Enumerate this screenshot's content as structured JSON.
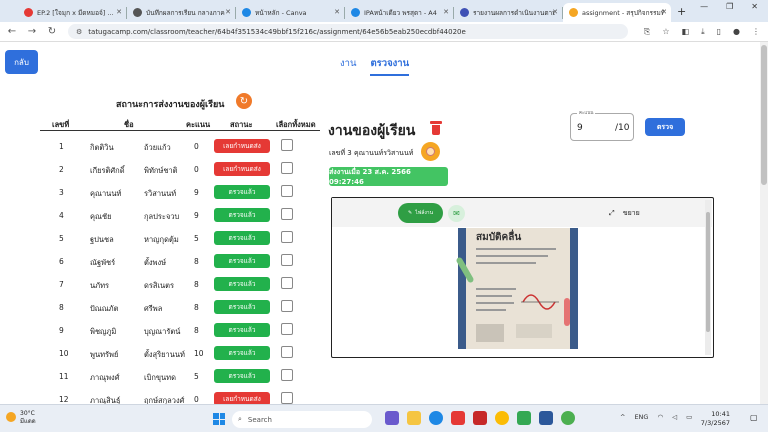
{
  "browser": {
    "tabs": [
      {
        "label": "EP.2 [ใจมุก x มีดหมอจ์] ...",
        "icon_color": "#e53935",
        "active": false
      },
      {
        "label": "บันทึกผลการเรียน กลางภาค",
        "icon_color": "#555555",
        "active": false
      },
      {
        "label": "หน้าหลัก - Canva",
        "icon_color": "#1e88e5",
        "active": false
      },
      {
        "label": "IPAหน้าเดียว พรสุดา - A4",
        "icon_color": "#1e88e5",
        "active": false
      },
      {
        "label": "รายงานผลการดำเนินงานตามมา",
        "icon_color": "#3f51b5",
        "active": false
      },
      {
        "label": "assignment - สรุปกิจกรรมที่เรีย",
        "icon_color": "#f5a623",
        "active": true
      }
    ],
    "url": "tatugacamp.com/classroom/teacher/64b4f351534c49bbf15f216c/assignment/64e56b5eab250ecdbf44020e"
  },
  "page": {
    "back_label": "กลับ",
    "tabs": [
      {
        "label": "งาน",
        "active": false
      },
      {
        "label": "ตรวจงาน",
        "active": true
      }
    ],
    "status_title": "สถานะการส่งงานของผู้เรียน",
    "columns": {
      "no": "เลขที่",
      "name": "ชื่อ",
      "score": "คะแนน",
      "status": "สถานะ",
      "select_all": "เลือกทั้งหมด"
    },
    "students": [
      {
        "no": "1",
        "first": "กิตติวิน",
        "last": "ถ้วยแก้ว",
        "score": "0",
        "status": "เลยกำหนดส่ง",
        "status_color": "#e53935"
      },
      {
        "no": "2",
        "first": "เกียรติศักดิ์",
        "last": "พิทักษ์ชาติ",
        "score": "0",
        "status": "เลยกำหนดส่ง",
        "status_color": "#e53935"
      },
      {
        "no": "3",
        "first": "คุณานนท์",
        "last": "รวิสานนท์",
        "score": "9",
        "status": "ตรวจแล้ว",
        "status_color": "#22b14c"
      },
      {
        "no": "4",
        "first": "คุณชัย",
        "last": "กุลประจวบ",
        "score": "9",
        "status": "ตรวจแล้ว",
        "status_color": "#22b14c"
      },
      {
        "no": "5",
        "first": "ฐปนชล",
        "last": "หาญกุดตุ้ม",
        "score": "5",
        "status": "ตรวจแล้ว",
        "status_color": "#22b14c"
      },
      {
        "no": "6",
        "first": "ณัฐพัชร์",
        "last": "ตั้งพงษ์",
        "score": "8",
        "status": "ตรวจแล้ว",
        "status_color": "#22b14c"
      },
      {
        "no": "7",
        "first": "นภัทร",
        "last": "ดรสิเนตร",
        "score": "8",
        "status": "ตรวจแล้ว",
        "status_color": "#22b14c"
      },
      {
        "no": "8",
        "first": "ปัณณภัต",
        "last": "ศรีพล",
        "score": "8",
        "status": "ตรวจแล้ว",
        "status_color": "#22b14c"
      },
      {
        "no": "9",
        "first": "พิชญภูมิ",
        "last": "บุญณารัตน์",
        "score": "8",
        "status": "ตรวจแล้ว",
        "status_color": "#22b14c"
      },
      {
        "no": "10",
        "first": "พูนทรัพย์",
        "last": "ตั้งสุริยานนท์",
        "score": "10",
        "status": "ตรวจแล้ว",
        "status_color": "#22b14c"
      },
      {
        "no": "11",
        "first": "ภาณุพงศ์",
        "last": "เบิกขุนทด",
        "score": "5",
        "status": "ตรวจแล้ว",
        "status_color": "#22b14c"
      },
      {
        "no": "12",
        "first": "ภาณุสินธุ์",
        "last": "ฤกษ์สกุลวงศ์",
        "score": "0",
        "status": "เลยกำหนดส่ง",
        "status_color": "#e53935"
      }
    ],
    "work_title": "งานของผู้เรียน",
    "student_info": "เลขที่ 3  คุณานนท์รวิสานนท์",
    "sent_at": "ส่งงานเมื่อ  23 ส.ค. 2566 09:27:46",
    "score_label": "คะแนน",
    "score_value": "9",
    "score_max": "/10",
    "check_label": "ตรวจ",
    "file_label": "ไฟล์งาน",
    "expand_label": "ขยาย",
    "doc_title": "สมบัติคลื่น"
  },
  "taskbar": {
    "temp": "30°C",
    "weather": "มีแดด",
    "search": "Search",
    "lang": "ENG",
    "time": "10:41",
    "date": "7/3/2567"
  }
}
